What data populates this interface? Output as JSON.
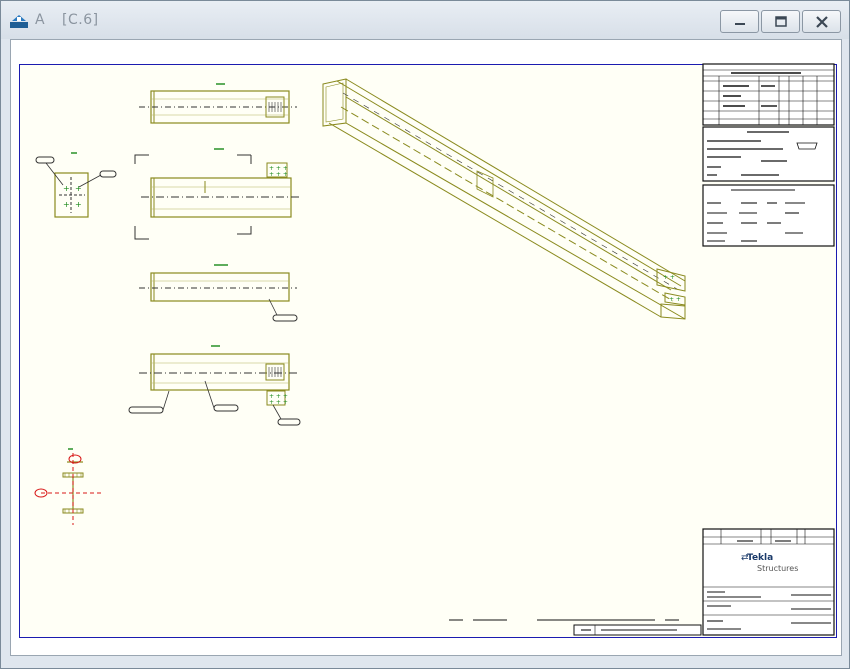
{
  "window": {
    "title_parts": [
      "A",
      "[C.6]"
    ]
  },
  "title_block": {
    "brand_name": "Tekla",
    "brand_subtitle": "Structures"
  },
  "colors": {
    "frame_border": "#1b1bb0",
    "part_outline": "#8a8a1e",
    "centerline": "#333333",
    "bolt": "#1a8a1a",
    "section_mark": "#d81818",
    "paper": "#fffff6"
  }
}
